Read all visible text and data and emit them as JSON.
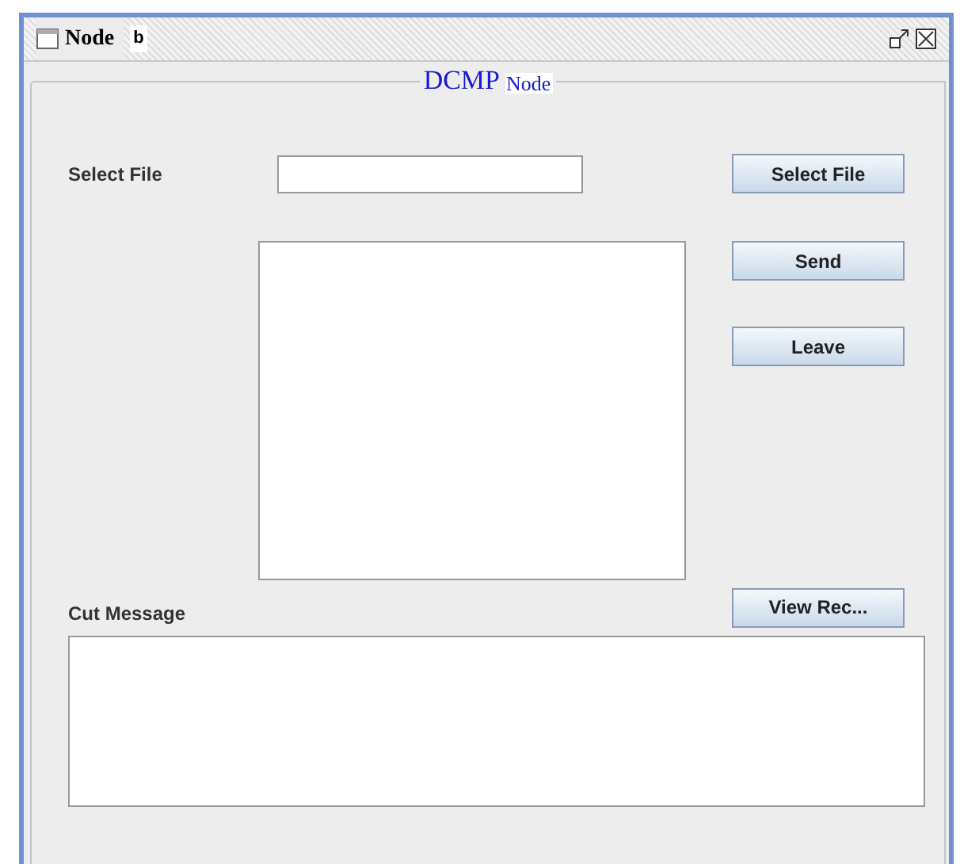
{
  "window": {
    "title": "Node",
    "tab_label": "b"
  },
  "panel": {
    "title": "DCMP",
    "subtitle": "Node"
  },
  "select_file": {
    "label": "Select File",
    "button": "Select File"
  },
  "buttons": [
    "Send",
    "Leave"
  ],
  "cut_message": {
    "label": "Cut Message",
    "button": "View Rec..."
  }
}
